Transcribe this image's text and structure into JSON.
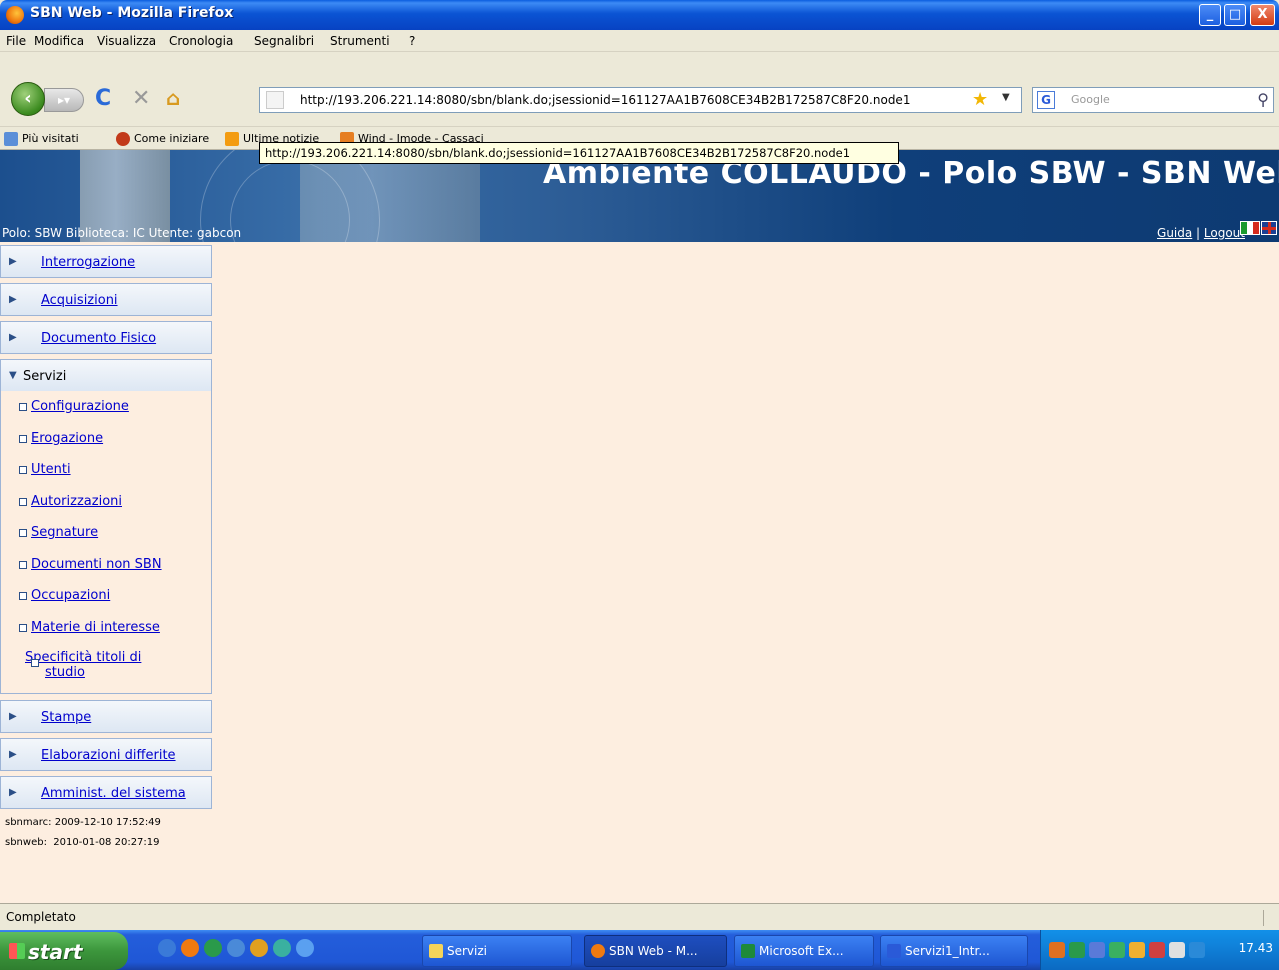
{
  "window": {
    "title": "SBN Web - Mozilla Firefox",
    "min": "_",
    "max": "□",
    "close": "X"
  },
  "menubar": [
    "File",
    "Modifica",
    "Visualizza",
    "Cronologia",
    "Segnalibri",
    "Strumenti",
    "?"
  ],
  "navbar": {
    "url": "http://193.206.221.14:8080/sbn/blank.do;jsessionid=161127AA1B7608CE34B2B172587C8F20.node1",
    "search_placeholder": "Google",
    "search_engine": "G"
  },
  "bookmarks": [
    "Più visitati",
    "Come iniziare",
    "Ultime notizie",
    "Wind - Imode - Cassaci"
  ],
  "tooltip": "http://193.206.221.14:8080/sbn/blank.do;jsessionid=161127AA1B7608CE34B2B172587C8F20.node1",
  "banner": {
    "title": "Ambiente COLLAUDO - Polo SBW - SBN Web",
    "info": "Polo: SBW  Biblioteca: IC  Utente: gabcon",
    "guida": "Guida",
    "sep": " | ",
    "logout": "Logout"
  },
  "sidebar": {
    "menus": [
      {
        "label": "Interrogazione",
        "open": false
      },
      {
        "label": "Acquisizioni",
        "open": false
      },
      {
        "label": "Documento Fisico",
        "open": false
      },
      {
        "label": "Servizi",
        "open": true
      }
    ],
    "servizi_items": [
      "Configurazione",
      "Erogazione",
      "Utenti",
      "Autorizzazioni",
      "Segnature",
      "Documenti non SBN",
      "Occupazioni",
      "Materie di interesse",
      "Specificità titoli di studio"
    ],
    "menus_after": [
      {
        "label": "Stampe"
      },
      {
        "label": "Elaborazioni differite"
      },
      {
        "label": "Amminist. del sistema"
      }
    ],
    "timestamps": [
      "sbnmarc: 2009-12-10 17:52:49",
      "sbnweb:  2010-01-08 20:27:19"
    ]
  },
  "statusbar": {
    "text": "Completato"
  },
  "taskbar": {
    "start": "start",
    "tasks": [
      "Servizi",
      "SBN Web - M...",
      "Microsoft Ex...",
      "Servizi1_Intr..."
    ],
    "clock": "17.43"
  },
  "colors": {
    "banner_bg": "#0d3a72",
    "content_bg": "#fdeee0",
    "link": "#0000cc",
    "taskbar": "#245edb"
  }
}
